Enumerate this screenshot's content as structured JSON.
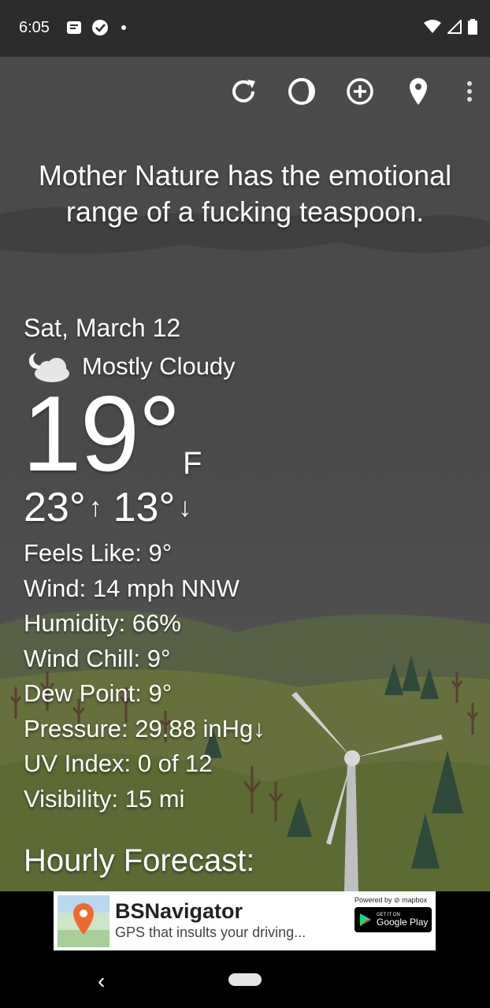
{
  "status_bar": {
    "time": "6:05",
    "left_icons": [
      "notification-icon",
      "check-circle-icon",
      "dot-icon"
    ],
    "right_icons": [
      "wifi-icon",
      "signal-icon",
      "battery-icon"
    ]
  },
  "toolbar": {
    "icons": [
      "refresh-icon",
      "theme-icon",
      "add-location-icon",
      "location-pin-icon",
      "more-vert-icon"
    ]
  },
  "quote": "Mother Nature has the emotional range of a fucking teaspoon.",
  "weather": {
    "date": "Sat, March 12",
    "condition": "Mostly Cloudy",
    "condition_icon": "night-cloudy-icon",
    "temperature": "19°",
    "unit": "F",
    "high": "23°",
    "high_arrow": "↑",
    "low": "13°",
    "low_arrow": "↓",
    "details": [
      "Feels Like:  9°",
      "Wind:  14 mph NNW",
      "Humidity:  66%",
      "Wind Chill:  9°",
      "Dew Point:  9°",
      "Pressure:  29.88 inHg↓",
      "UV Index:  0 of 12",
      "Visibility:  15 mi"
    ],
    "hourly_heading": "Hourly Forecast:"
  },
  "ad": {
    "title": "BSNavigator",
    "subtitle": "GPS that insults your driving...",
    "powered_by": "Powered by ⊘ mapbox",
    "play_small": "GET IT ON",
    "play_big": "Google Play"
  },
  "nav": {
    "back": "‹"
  },
  "colors": {
    "sky": "#4a4a4a",
    "status_bar": "#2c2c2c",
    "hills": "#5e6a3a",
    "trees": "#2f4a2c"
  }
}
